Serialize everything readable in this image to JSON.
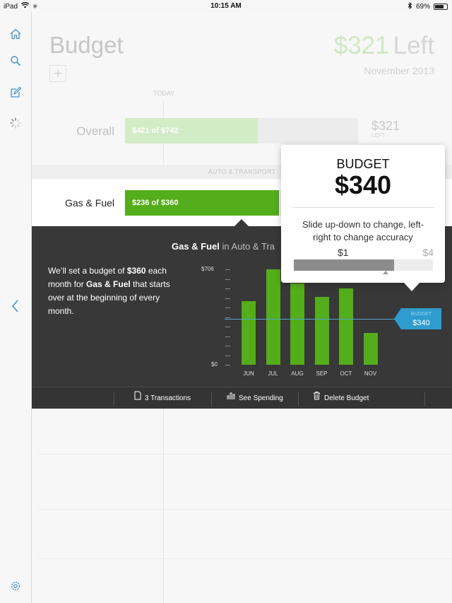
{
  "status_bar": {
    "device": "iPad",
    "time": "10:15 AM",
    "battery": "69%",
    "battery_level": 0.69
  },
  "header": {
    "title": "Budget",
    "add_label": "+",
    "left_amount": "$321",
    "left_word": "Left",
    "period": "November 2013",
    "today_label": "TODAY"
  },
  "overall": {
    "label": "Overall",
    "bar_text": "$421 of $742",
    "progress": 0.57,
    "remaining": "$321",
    "remaining_caption": "LEFT"
  },
  "category_header": "AUTO & TRANSPORT",
  "gas": {
    "label": "Gas & Fuel",
    "bar_text": "$236 of $360",
    "progress": 0.66
  },
  "panel": {
    "title": "Gas & Fuel",
    "subtitle": "in Auto & Tra",
    "desc_1": "We’ll set a budget of ",
    "desc_amount": "$360",
    "desc_2": " each month for ",
    "desc_cat": "Gas & Fuel",
    "desc_3": " that starts over at the beginning of every month.",
    "footer": {
      "transactions": "3 Transactions",
      "see_spending": "See Spending",
      "delete_budget": "Delete Budget"
    }
  },
  "chart_data": {
    "type": "bar",
    "categories": [
      "JUN",
      "JUL",
      "AUG",
      "SEP",
      "OCT",
      "NOV"
    ],
    "values": [
      470,
      706,
      600,
      500,
      565,
      235
    ],
    "ylim": [
      0,
      706
    ],
    "y_tick_labels": [
      "$706",
      "$0"
    ],
    "budget_value": 340,
    "budget_tag_label": "BUDGET",
    "budget_tag_value": "$340"
  },
  "popover": {
    "title": "BUDGET",
    "value": "$340",
    "hint": "Slide up-down to change, left-right to change accuracy",
    "scale_low": "$1",
    "scale_high": "$4",
    "accuracy_level": 0.72
  },
  "colors": {
    "accent_green": "#54ad1a",
    "accent_blue": "#2f9ccf",
    "rail_icon": "#4a90c8",
    "panel_bg": "#383838"
  }
}
